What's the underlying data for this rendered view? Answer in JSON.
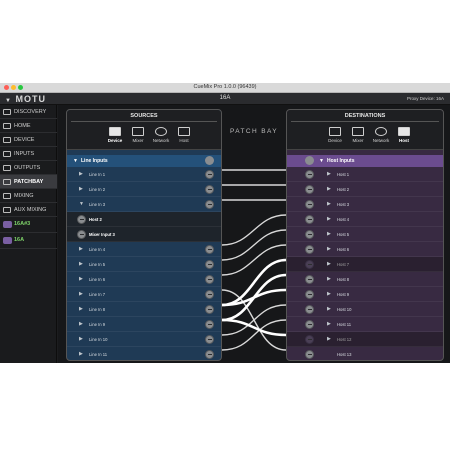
{
  "window": {
    "title": "CueMix Pro 1.0.0 (96439)"
  },
  "header": {
    "logo": "MOTU",
    "device_title": "16A",
    "proxy": "Proxy Device: 16A"
  },
  "sidebar": {
    "items": [
      {
        "label": "DISCOVERY",
        "icon": "discovery-icon"
      },
      {
        "label": "HOME",
        "icon": "home-icon"
      },
      {
        "label": "DEVICE",
        "icon": "device-icon"
      },
      {
        "label": "INPUTS",
        "icon": "inputs-icon"
      },
      {
        "label": "OUTPUTS",
        "icon": "outputs-icon"
      },
      {
        "label": "PATCHBAY",
        "icon": "patchbay-icon"
      },
      {
        "label": "MIXING",
        "icon": "mixing-icon"
      },
      {
        "label": "AUX MIXING",
        "icon": "aux-mixing-icon"
      },
      {
        "label": "16A#3",
        "icon": "device-16a-icon"
      },
      {
        "label": "16A",
        "icon": "device-16a-icon"
      }
    ]
  },
  "patch_bay_label": "PATCH BAY",
  "sources": {
    "title": "SOURCES",
    "tabs": [
      "Device",
      "Mixer",
      "Network",
      "Host"
    ],
    "selected_tab": "Device",
    "group": "Line Inputs",
    "rows": [
      "Line In 1",
      "Line In 2",
      "Line In 3",
      "Host 2",
      "Mixer Input 3",
      "Line In 4",
      "Line In 5",
      "Line In 6",
      "Line In 7",
      "Line In 8",
      "Line In 9",
      "Line In 10",
      "Line In 11"
    ]
  },
  "destinations": {
    "title": "DESTINATIONS",
    "tabs": [
      "Device",
      "Mixer",
      "Network",
      "Host"
    ],
    "selected_tab": "Host",
    "group": "Host Inputs",
    "rows": [
      "Host 1",
      "Host 2",
      "Host 3",
      "Host 4",
      "Host 5",
      "Host 6",
      "Host 7",
      "Host 8",
      "Host 9",
      "Host 10",
      "Host 11",
      "Host 12",
      "Host 13"
    ]
  },
  "colors": {
    "accent_source": "#24517a",
    "accent_dest": "#6b4c8f",
    "active_device": "#7fd36a"
  }
}
